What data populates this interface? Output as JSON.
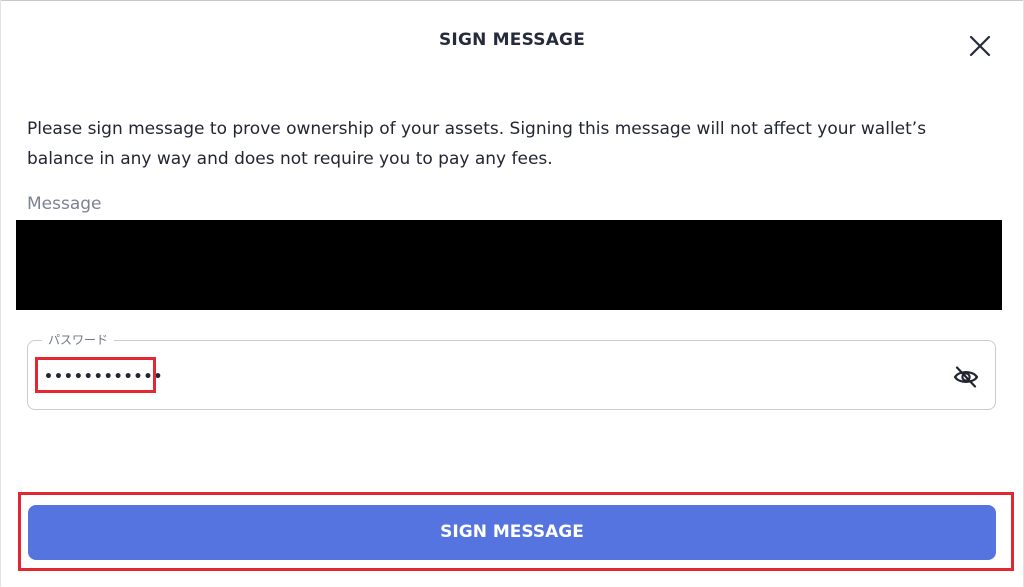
{
  "dialog": {
    "title": "SIGN MESSAGE",
    "close_icon": "close-icon",
    "description": "Please sign message to prove ownership of your assets. Signing this message will not affect your wallet’s balance in any way and does not require you to pay any fees.",
    "message_label": "Message",
    "message_content": ""
  },
  "password": {
    "label": "パスワード",
    "value": "••••••••••••",
    "visibility_icon": "eye-off-icon"
  },
  "actions": {
    "sign_label": "SIGN MESSAGE"
  },
  "colors": {
    "primary": "#5674e0",
    "highlight": "#e32833",
    "title": "#262b3b",
    "label": "#7c8294",
    "redaction": "#000000"
  }
}
